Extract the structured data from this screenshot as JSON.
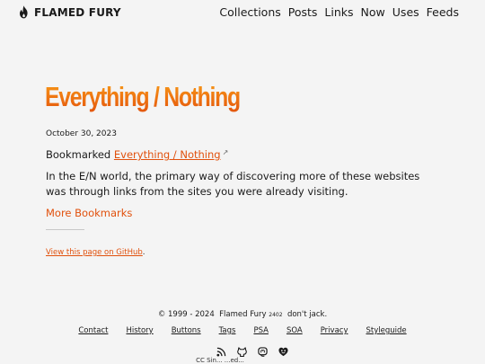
{
  "header": {
    "brand": "FLAMED FURY",
    "brand_icon": "flame-icon",
    "nav": [
      "Collections",
      "Posts",
      "Links",
      "Now",
      "Uses",
      "Feeds"
    ]
  },
  "post": {
    "title": "Everything / Nothing",
    "date": "October 30, 2023",
    "bookmark_prefix": "Bookmarked",
    "bookmark_link": "Everything / Nothing",
    "external_glyph": "↗",
    "body": "In the E/N world, the primary way of discovering more of these websites was through links from the sites you were already visiting.",
    "more_link": "More Bookmarks",
    "github_link": "View this page on GitHub",
    "github_suffix": "."
  },
  "footer": {
    "copyright": "© 1999 - 2024",
    "site_name": "Flamed Fury",
    "version": "2402",
    "tagline": "don't jack.",
    "links": [
      "Contact",
      "History",
      "Buttons",
      "Tags",
      "PSA",
      "SOA",
      "Privacy",
      "Styleguide"
    ],
    "icons": [
      "rss-icon",
      "github-icon",
      "mastodon-icon",
      "heart-face-icon"
    ],
    "license": "CC Sin... ...ed..."
  },
  "colors": {
    "accent": "#e1510d",
    "background": "#f4f4f4",
    "text": "#1a1a1a"
  }
}
